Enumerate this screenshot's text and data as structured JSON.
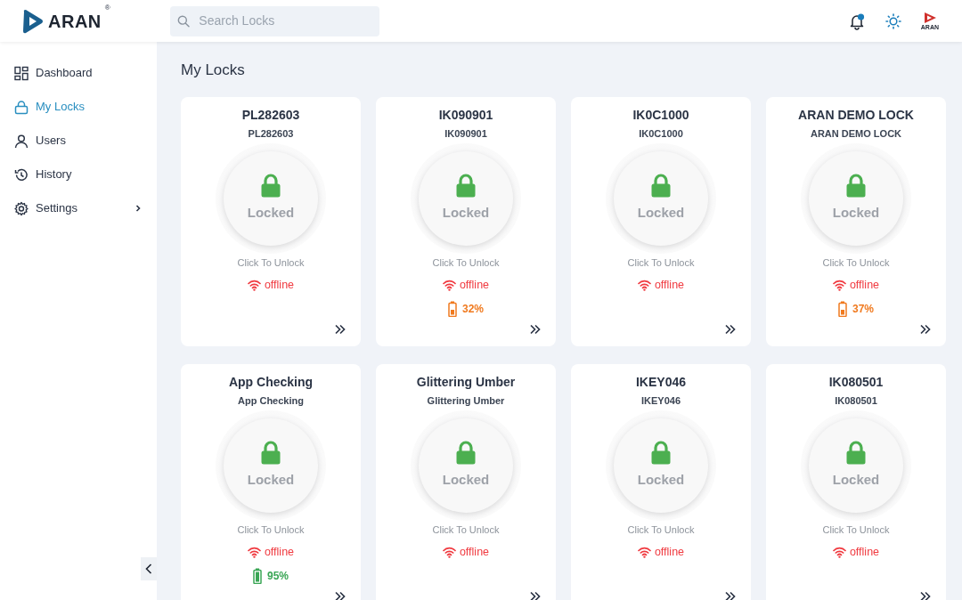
{
  "brand": {
    "name": "ARAN",
    "mark": "®"
  },
  "search": {
    "placeholder": "Search Locks"
  },
  "header": {
    "has_unread": true,
    "avatar_text": "ARAN"
  },
  "sidebar": {
    "items": [
      {
        "label": "Dashboard",
        "selected": false
      },
      {
        "label": "My Locks",
        "selected": true
      },
      {
        "label": "Users",
        "selected": false
      },
      {
        "label": "History",
        "selected": false
      },
      {
        "label": "Settings",
        "selected": false,
        "expanded": false
      }
    ]
  },
  "page": {
    "title": "My Locks"
  },
  "locks": [
    {
      "name": "PL282603",
      "subtitle": "PL282603",
      "locked": true,
      "state_text": "Locked",
      "hint": "Click To Unlock",
      "online": false,
      "status_text": "offline"
    },
    {
      "name": "IK090901",
      "subtitle": "IK090901",
      "locked": true,
      "state_text": "Locked",
      "hint": "Click To Unlock",
      "online": false,
      "status_text": "offline",
      "battery": {
        "reading": "32%",
        "low": true
      }
    },
    {
      "name": "IK0C1000",
      "subtitle": "IK0C1000",
      "locked": true,
      "state_text": "Locked",
      "hint": "Click To Unlock",
      "online": false,
      "status_text": "offline"
    },
    {
      "name": "ARAN DEMO LOCK",
      "subtitle": "ARAN DEMO LOCK",
      "locked": true,
      "state_text": "Locked",
      "hint": "Click To Unlock",
      "online": false,
      "status_text": "offline",
      "battery": {
        "reading": "37%",
        "low": true
      }
    },
    {
      "name": "App Checking",
      "subtitle": "App Checking",
      "locked": true,
      "state_text": "Locked",
      "hint": "Click To Unlock",
      "online": false,
      "status_text": "offline",
      "battery": {
        "reading": "95%",
        "low": false
      }
    },
    {
      "name": "Glittering Umber",
      "subtitle": "Glittering Umber",
      "locked": true,
      "state_text": "Locked",
      "hint": "Click To Unlock",
      "online": false,
      "status_text": "offline"
    },
    {
      "name": "IKEY046",
      "subtitle": "IKEY046",
      "locked": true,
      "state_text": "Locked",
      "hint": "Click To Unlock",
      "online": false,
      "status_text": "offline"
    },
    {
      "name": "IK080501",
      "subtitle": "IK080501",
      "locked": true,
      "state_text": "Locked",
      "hint": "Click To Unlock",
      "online": false,
      "status_text": "offline"
    }
  ]
}
